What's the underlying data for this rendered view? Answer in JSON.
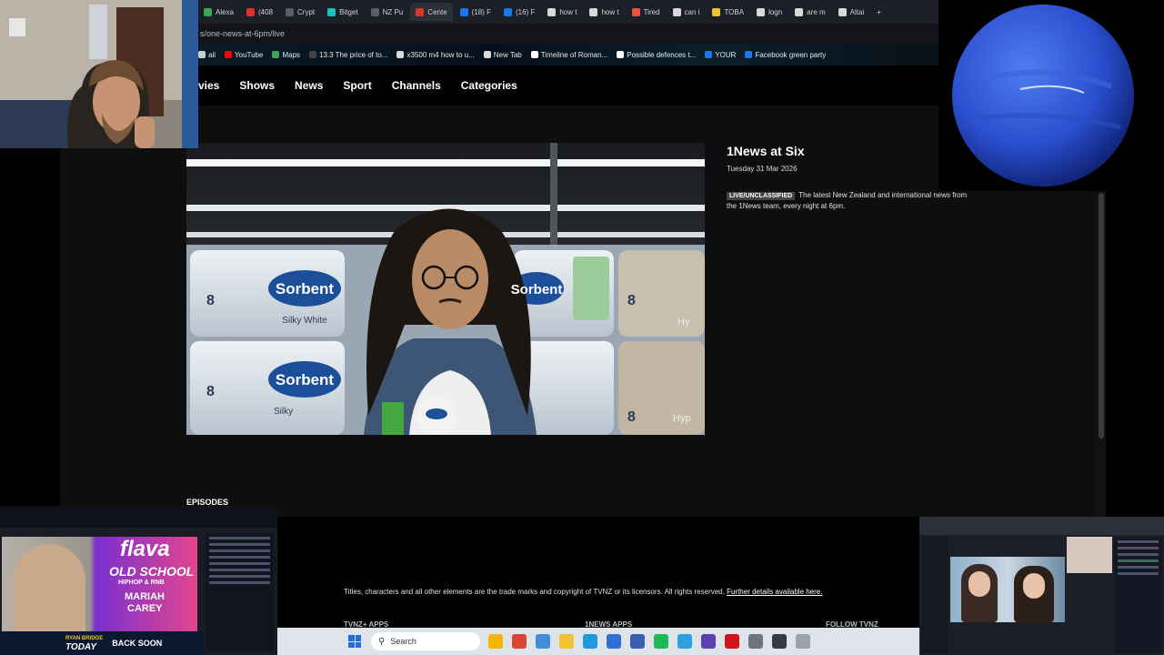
{
  "browser": {
    "tabs": [
      {
        "label": "Alexa",
        "color": "#3aa55c"
      },
      {
        "label": "(408",
        "color": "#e03131"
      },
      {
        "label": "Crypt",
        "color": "#555f6e"
      },
      {
        "label": "Bitget",
        "color": "#19c3c3"
      },
      {
        "label": "NZ Pu",
        "color": "#555f6e"
      },
      {
        "label": "Cente",
        "color": "#d9382d"
      },
      {
        "label": "(18) F",
        "color": "#1877f2"
      },
      {
        "label": "(16) F",
        "color": "#1877f2"
      },
      {
        "label": "how t",
        "color": "#d9d9d9"
      },
      {
        "label": "how t",
        "color": "#d9d9d9"
      },
      {
        "label": "Tired",
        "color": "#e8553d"
      },
      {
        "label": "can i",
        "color": "#d9d9d9"
      },
      {
        "label": "TOBA",
        "color": "#f2c230"
      },
      {
        "label": "logn",
        "color": "#d9d9d9"
      },
      {
        "label": "are m",
        "color": "#d9d9d9"
      },
      {
        "label": "Altai",
        "color": "#d9d9d9"
      }
    ],
    "url": "s/one-news-at-6pm/live",
    "bookmarks": [
      {
        "label": "ail",
        "color": "#cccccc"
      },
      {
        "label": "YouTube",
        "color": "#ff0000"
      },
      {
        "label": "Maps",
        "color": "#34a853"
      },
      {
        "label": "13.3 The price of to...",
        "color": "#444444"
      },
      {
        "label": "x3500 m4 how to u...",
        "color": "#d9d9d9"
      },
      {
        "label": "New Tab",
        "color": "#d9d9d9"
      },
      {
        "label": "Timeline of Roman...",
        "color": "#ffffff"
      },
      {
        "label": "Possible defences t...",
        "color": "#ffffff"
      },
      {
        "label": "YOUR",
        "color": "#1877f2"
      },
      {
        "label": "Facebook green party",
        "color": "#1877f2"
      }
    ]
  },
  "site": {
    "nav": [
      "vies",
      "Shows",
      "News",
      "Sport",
      "Channels",
      "Categories"
    ],
    "program": {
      "title": "1News at Six",
      "date": "Tuesday 31 Mar 2026",
      "tag": "LIVE/UNCLASSIFIED",
      "description": "The latest New Zealand and international news from the 1News team, every night at 6pm."
    },
    "episodes_label": "EPISODES",
    "footer": {
      "copyright": "Titles, characters and all other elements are the trade marks and copyright of TVNZ or its licensors. All rights reserved.",
      "link": "Further details available here.",
      "headings": [
        "TVNZ+ APPS",
        "1NEWS APPS",
        "FOLLOW TVNZ"
      ]
    }
  },
  "video": {
    "product_brand": "Sorbent",
    "product_line": "Silky White",
    "ply": "8",
    "product_variant": "Silky",
    "variant_partial": "Hy",
    "variant_partial2": "Hyp"
  },
  "taskbar": {
    "search_placeholder": "Search",
    "icons": [
      {
        "name": "file-explorer-icon",
        "color": "#f4b400"
      },
      {
        "name": "chrome-icon",
        "color": "#db4437"
      },
      {
        "name": "photos-icon",
        "color": "#3f8fd8"
      },
      {
        "name": "folder-icon",
        "color": "#f2c230"
      },
      {
        "name": "edge-icon",
        "color": "#1f9ade"
      },
      {
        "name": "store-icon",
        "color": "#2f6fd6"
      },
      {
        "name": "calendar-icon",
        "color": "#3a5fb0"
      },
      {
        "name": "spotify-icon",
        "color": "#1db954"
      },
      {
        "name": "telegram-icon",
        "color": "#2aa3e0"
      },
      {
        "name": "obs-icon",
        "color": "#5c3fb0"
      },
      {
        "name": "acrobat-icon",
        "color": "#d3121a"
      },
      {
        "name": "settings-icon",
        "color": "#6d7480"
      },
      {
        "name": "app-icon",
        "color": "#333a44"
      },
      {
        "name": "overflow-icon",
        "color": "#9aa3ad"
      }
    ]
  },
  "overlays": {
    "promo": {
      "brand": "flava",
      "line1": "OLD SCHOOL",
      "line2": "HIPHOP & RNB",
      "artist1": "MARIAH",
      "artist2": "CAREY",
      "show_host": "RYAN BRIDGE",
      "show_name": "TODAY",
      "status": "BACK SOON"
    }
  }
}
